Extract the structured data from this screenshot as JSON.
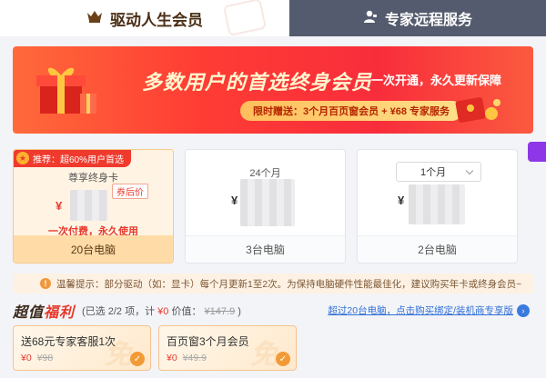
{
  "tabs": {
    "active_label": "驱动人生会员",
    "inactive_label": "专家远程服务",
    "active_icon": "crown-icon",
    "inactive_icon": "support-agent-icon"
  },
  "banner": {
    "headline": "多数用户的首选终身会员",
    "slogan": "一次开通，永久更新保障",
    "promo": "限时赠送：3个月百页窗会员 + ¥68 专家服务"
  },
  "plans": [
    {
      "badge": "推荐：超60%用户首选",
      "title": "尊享终身卡",
      "currency": "¥",
      "coupon_label": "券后价",
      "note": "一次付费，永久使用",
      "devices": "20台电脑",
      "selected": true
    },
    {
      "title": "24个月",
      "currency": "¥",
      "devices": "3台电脑",
      "selected": false
    },
    {
      "dropdown_value": "1个月",
      "currency": "¥",
      "devices": "2台电脑",
      "selected": false
    }
  ],
  "tip": {
    "text": "温馨提示：部分驱动（如：显卡）每个月更新1至2次。为保持电脑硬件性能最佳化，建议购买年卡或终身会员~"
  },
  "benefits": {
    "title_main": "超值",
    "title_accent": "福利",
    "selected_info": "(已选 2/2 项，计",
    "total": "¥0",
    "value_label": "价值：",
    "value": "¥147.9",
    "close_paren": ")",
    "link_text": "超过20台电脑，点击购买绑定/装机商专享版"
  },
  "offers": [
    {
      "name": "送68元专家客服1次",
      "price": "¥0",
      "original": "¥98",
      "watermark": "免"
    },
    {
      "name": "百页窗3个月会员",
      "price": "¥0",
      "original": "¥49.9",
      "watermark": "免"
    }
  ],
  "colors": {
    "accent_red": "#e8392b",
    "tab_dark": "#545b6e",
    "selected_card": "#fff4e4",
    "gold": "#ffdca7"
  }
}
